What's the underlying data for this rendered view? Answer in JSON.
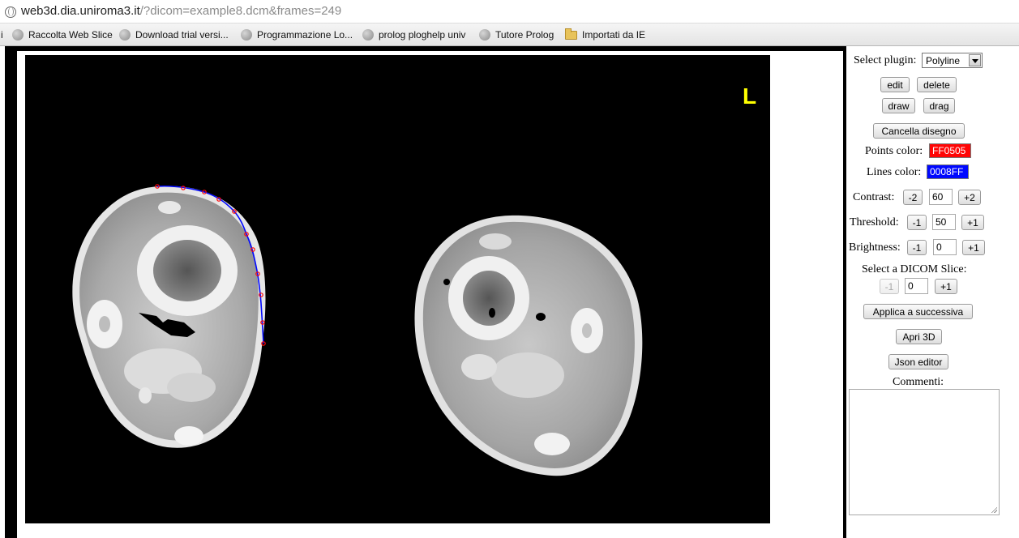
{
  "browser": {
    "url_host": "web3d.dia.uniroma3.it",
    "url_path": "/?dicom=example8.dcm&frames=249",
    "bookmarks": [
      {
        "label": "i",
        "icon": "none"
      },
      {
        "label": "Raccolta Web Slice",
        "icon": "globe-icon"
      },
      {
        "label": "Download trial versi...",
        "icon": "globe-icon"
      },
      {
        "label": "Programmazione Lo...",
        "icon": "globe-icon"
      },
      {
        "label": "prolog ploghelp univ",
        "icon": "globe-icon"
      },
      {
        "label": "Tutore Prolog",
        "icon": "globe-icon"
      },
      {
        "label": "Importati da IE",
        "icon": "folder-icon"
      }
    ]
  },
  "viewer": {
    "orientation_marker": "L",
    "orientation_color": "#ffff00",
    "polyline_points_color": "#ff0505",
    "polyline_lines_color": "#0008ff"
  },
  "panel": {
    "select_plugin_label": "Select plugin:",
    "plugin_value": "Polyline",
    "edit_label": "edit",
    "delete_label": "delete",
    "draw_label": "draw",
    "drag_label": "drag",
    "clear_drawing_label": "Cancella disegno",
    "points_color_label": "Points color:",
    "points_color_value": "FF0505",
    "lines_color_label": "Lines color:",
    "lines_color_value": "0008FF",
    "contrast_label": "Contrast:",
    "contrast_dec": "-2",
    "contrast_value": "60",
    "contrast_inc": "+2",
    "threshold_label": "Threshold:",
    "threshold_dec": "-1",
    "threshold_value": "50",
    "threshold_inc": "+1",
    "brightness_label": "Brightness:",
    "brightness_dec": "-1",
    "brightness_value": "0",
    "brightness_inc": "+1",
    "slice_label": "Select a DICOM Slice:",
    "slice_dec": "-1",
    "slice_value": "0",
    "slice_inc": "+1",
    "apply_next_label": "Applica a successiva",
    "open_3d_label": "Apri 3D",
    "json_editor_label": "Json editor",
    "comments_label": "Commenti:"
  }
}
